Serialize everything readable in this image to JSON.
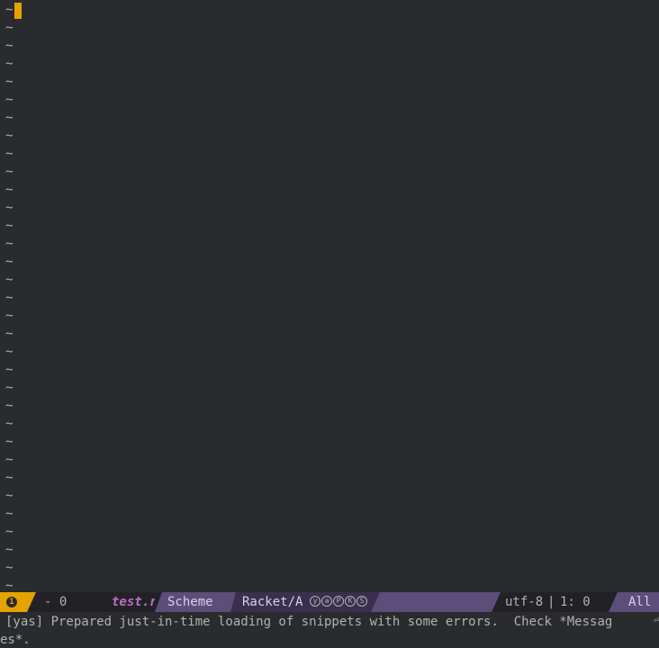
{
  "editor": {
    "empty_line_marker": "~",
    "empty_line_count": 33,
    "cursor_color": "#e6a300"
  },
  "modeline": {
    "window_number": "1",
    "buffer_state": "- 0",
    "buffer_name": "test.rkt",
    "major_mode": "Scheme",
    "minor_mode_text": "Racket/A",
    "minor_mode_badges": [
      "y",
      "a",
      "P",
      "K",
      "S"
    ],
    "encoding": "utf-8",
    "separator": "|",
    "line_col": "1: 0",
    "scroll_position": "All",
    "colors": {
      "accent": "#e6a300",
      "bar": "#5d4d7a",
      "dark": "#222226",
      "buffer_name": "#bc6ec5"
    }
  },
  "echo_area": {
    "line1": "[yas] Prepared just-in-time loading of snippets with some errors.  Check *Messag",
    "line2": "es*."
  }
}
